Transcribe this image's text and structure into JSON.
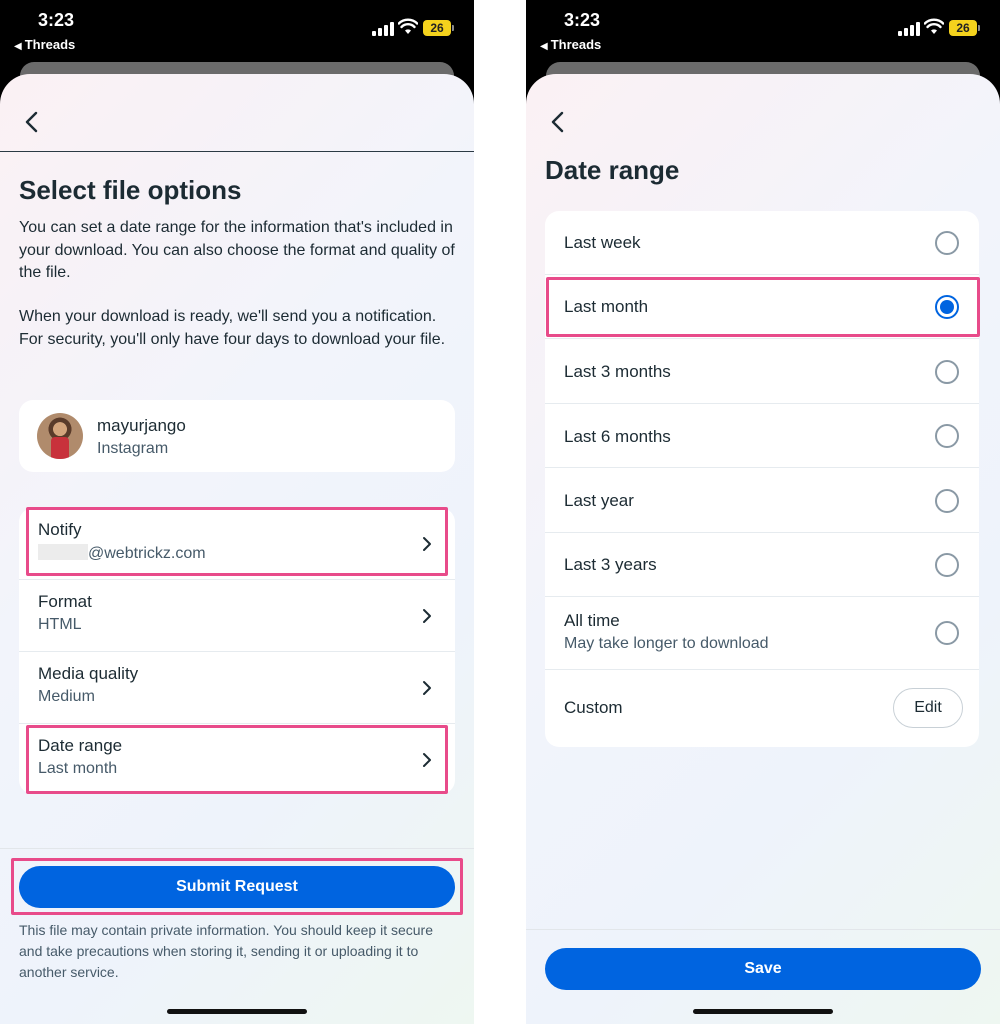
{
  "status_bar": {
    "time": "3:23",
    "back_app": "Threads",
    "battery": "26"
  },
  "left": {
    "title": "Select file options",
    "paragraph1": "You can set a date range for the information that's included in your download. You can also choose the format and quality of the file.",
    "paragraph2": "When your download is ready, we'll send you a notification. For security, you'll only have four days to download your file.",
    "account": {
      "name": "mayurjango",
      "platform": "Instagram"
    },
    "options": [
      {
        "title": "Notify",
        "value": "@webtrickz.com"
      },
      {
        "title": "Format",
        "value": "HTML"
      },
      {
        "title": "Media quality",
        "value": "Medium"
      },
      {
        "title": "Date range",
        "value": "Last month"
      }
    ],
    "submit_label": "Submit Request",
    "footnote": "This file may contain private information. You should keep it secure and take precautions when storing it, sending it or uploading it to another service."
  },
  "right": {
    "title": "Date range",
    "options": [
      {
        "label": "Last week",
        "selected": false
      },
      {
        "label": "Last month",
        "selected": true
      },
      {
        "label": "Last 3 months",
        "selected": false
      },
      {
        "label": "Last 6 months",
        "selected": false
      },
      {
        "label": "Last year",
        "selected": false
      },
      {
        "label": "Last 3 years",
        "selected": false
      },
      {
        "label": "All time",
        "sublabel": "May take longer to download",
        "selected": false
      }
    ],
    "custom_label": "Custom",
    "edit_label": "Edit",
    "save_label": "Save"
  },
  "colors": {
    "primary": "#0064e0",
    "highlight": "#e84b8a",
    "text": "#1c2b33",
    "secondary_text": "#465a69"
  }
}
